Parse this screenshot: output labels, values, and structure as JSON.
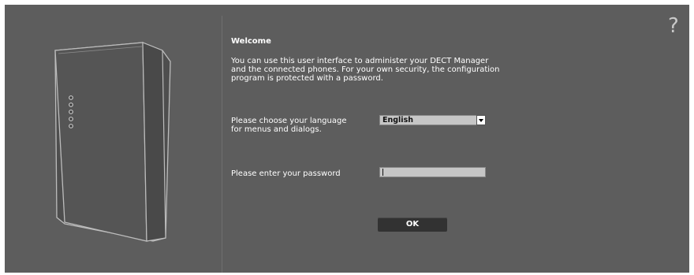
{
  "help": {
    "label": "?"
  },
  "welcome": {
    "title": "Welcome",
    "lines": [
      "You can use this user interface to administer your DECT Manager",
      "and the connected phones. For your own security, the configuration",
      "program is protected with a password."
    ]
  },
  "language": {
    "label_lines": [
      "Please choose your language",
      "for menus and dialogs."
    ],
    "selected": "English"
  },
  "password": {
    "label": "Please enter your password",
    "value": ""
  },
  "ok_button": {
    "label": "OK"
  },
  "colors": {
    "panel_bg": "#5d5d5d",
    "input_bg": "#c6c6c6",
    "button_bg": "#323232",
    "text": "#ffffff"
  },
  "icons": {
    "help": "question-mark-icon",
    "dropdown": "chevron-down-icon",
    "device": "dect-base-station-illustration"
  }
}
